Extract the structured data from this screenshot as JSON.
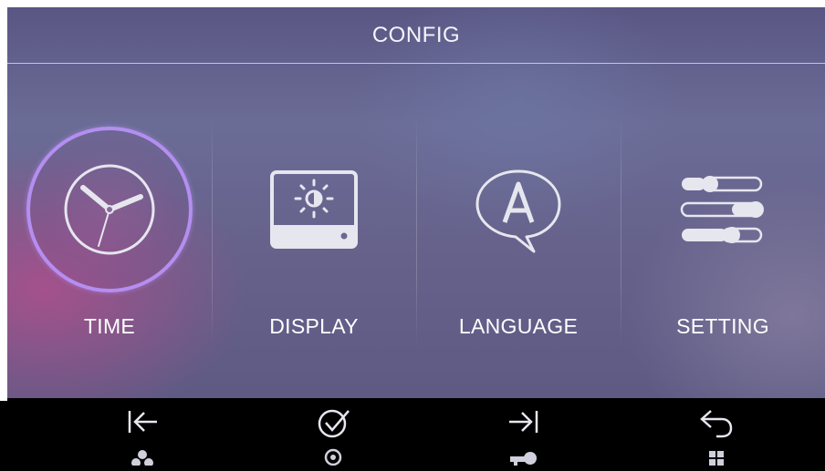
{
  "header": {
    "title": "CONFIG"
  },
  "tiles": [
    {
      "label": "TIME",
      "icon": "clock-icon",
      "selected": true
    },
    {
      "label": "DISPLAY",
      "icon": "brightness-display-icon",
      "selected": false
    },
    {
      "label": "LANGUAGE",
      "icon": "language-icon",
      "selected": false
    },
    {
      "label": "SETTING",
      "icon": "sliders-icon",
      "selected": false
    }
  ],
  "softkeys": [
    {
      "icon": "previous-icon",
      "sub_icon": "person-icon"
    },
    {
      "icon": "confirm-icon",
      "sub_icon": "monitor-icon"
    },
    {
      "icon": "next-icon",
      "sub_icon": "key-icon"
    },
    {
      "icon": "back-icon",
      "sub_icon": "grid-icon"
    }
  ],
  "colors": {
    "accent": "#b48ef0",
    "icon": "#e6e6ef",
    "text": "#ffffff",
    "bar": "#000000"
  }
}
